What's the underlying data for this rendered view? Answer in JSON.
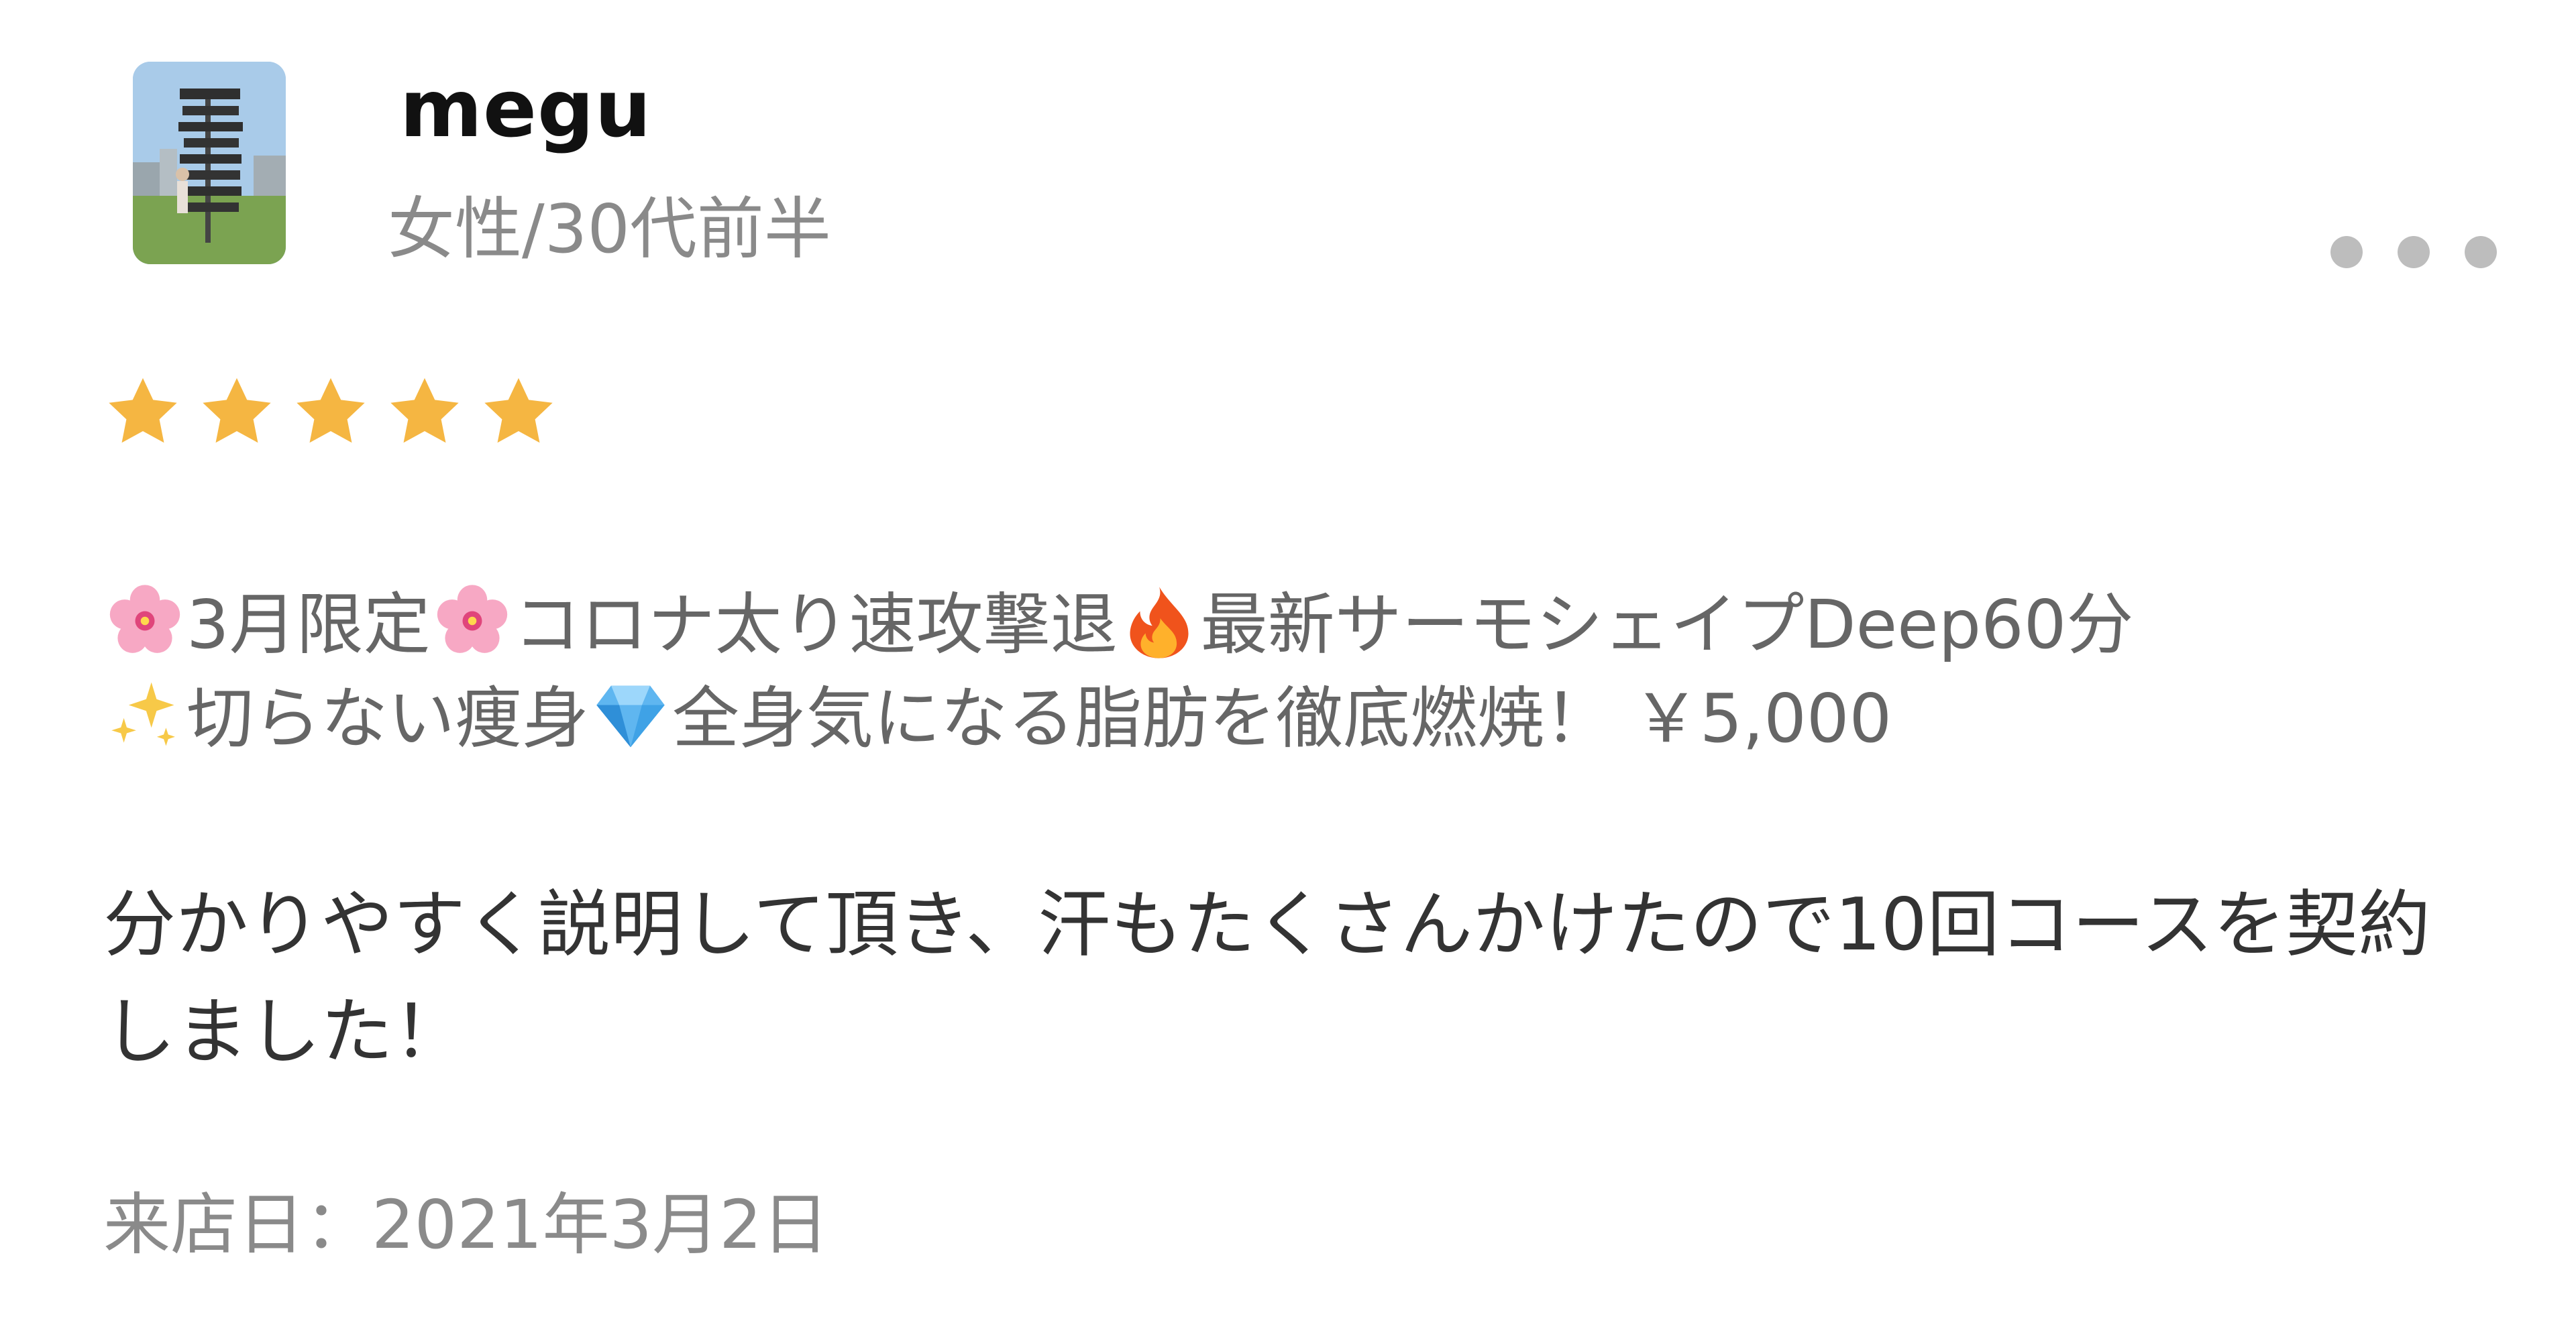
{
  "user": {
    "name": "megu",
    "meta": "女性/30代前半"
  },
  "rating": {
    "value": 5,
    "max": 5,
    "star_color": "#f5b642"
  },
  "icons": {
    "avatar": "user-avatar-photo",
    "more": "more-options-icon",
    "star": "star-icon",
    "blossom": "cherry-blossom-icon",
    "fire": "fire-icon",
    "sparkles": "sparkles-icon",
    "gem": "gem-icon"
  },
  "menu": {
    "seg1": "3月限定",
    "seg2": "コロナ太り速攻撃退",
    "seg3": "最新サーモシェイプDeep60分",
    "seg4": "切らない痩身",
    "seg5": "全身気になる脂肪を徹底燃焼！ ￥5,000"
  },
  "review": {
    "text": "分かりやすく説明して頂き、汗もたくさんかけたので10回コースを契約しました！"
  },
  "visit": {
    "label": "来店日：2021年3月2日"
  }
}
